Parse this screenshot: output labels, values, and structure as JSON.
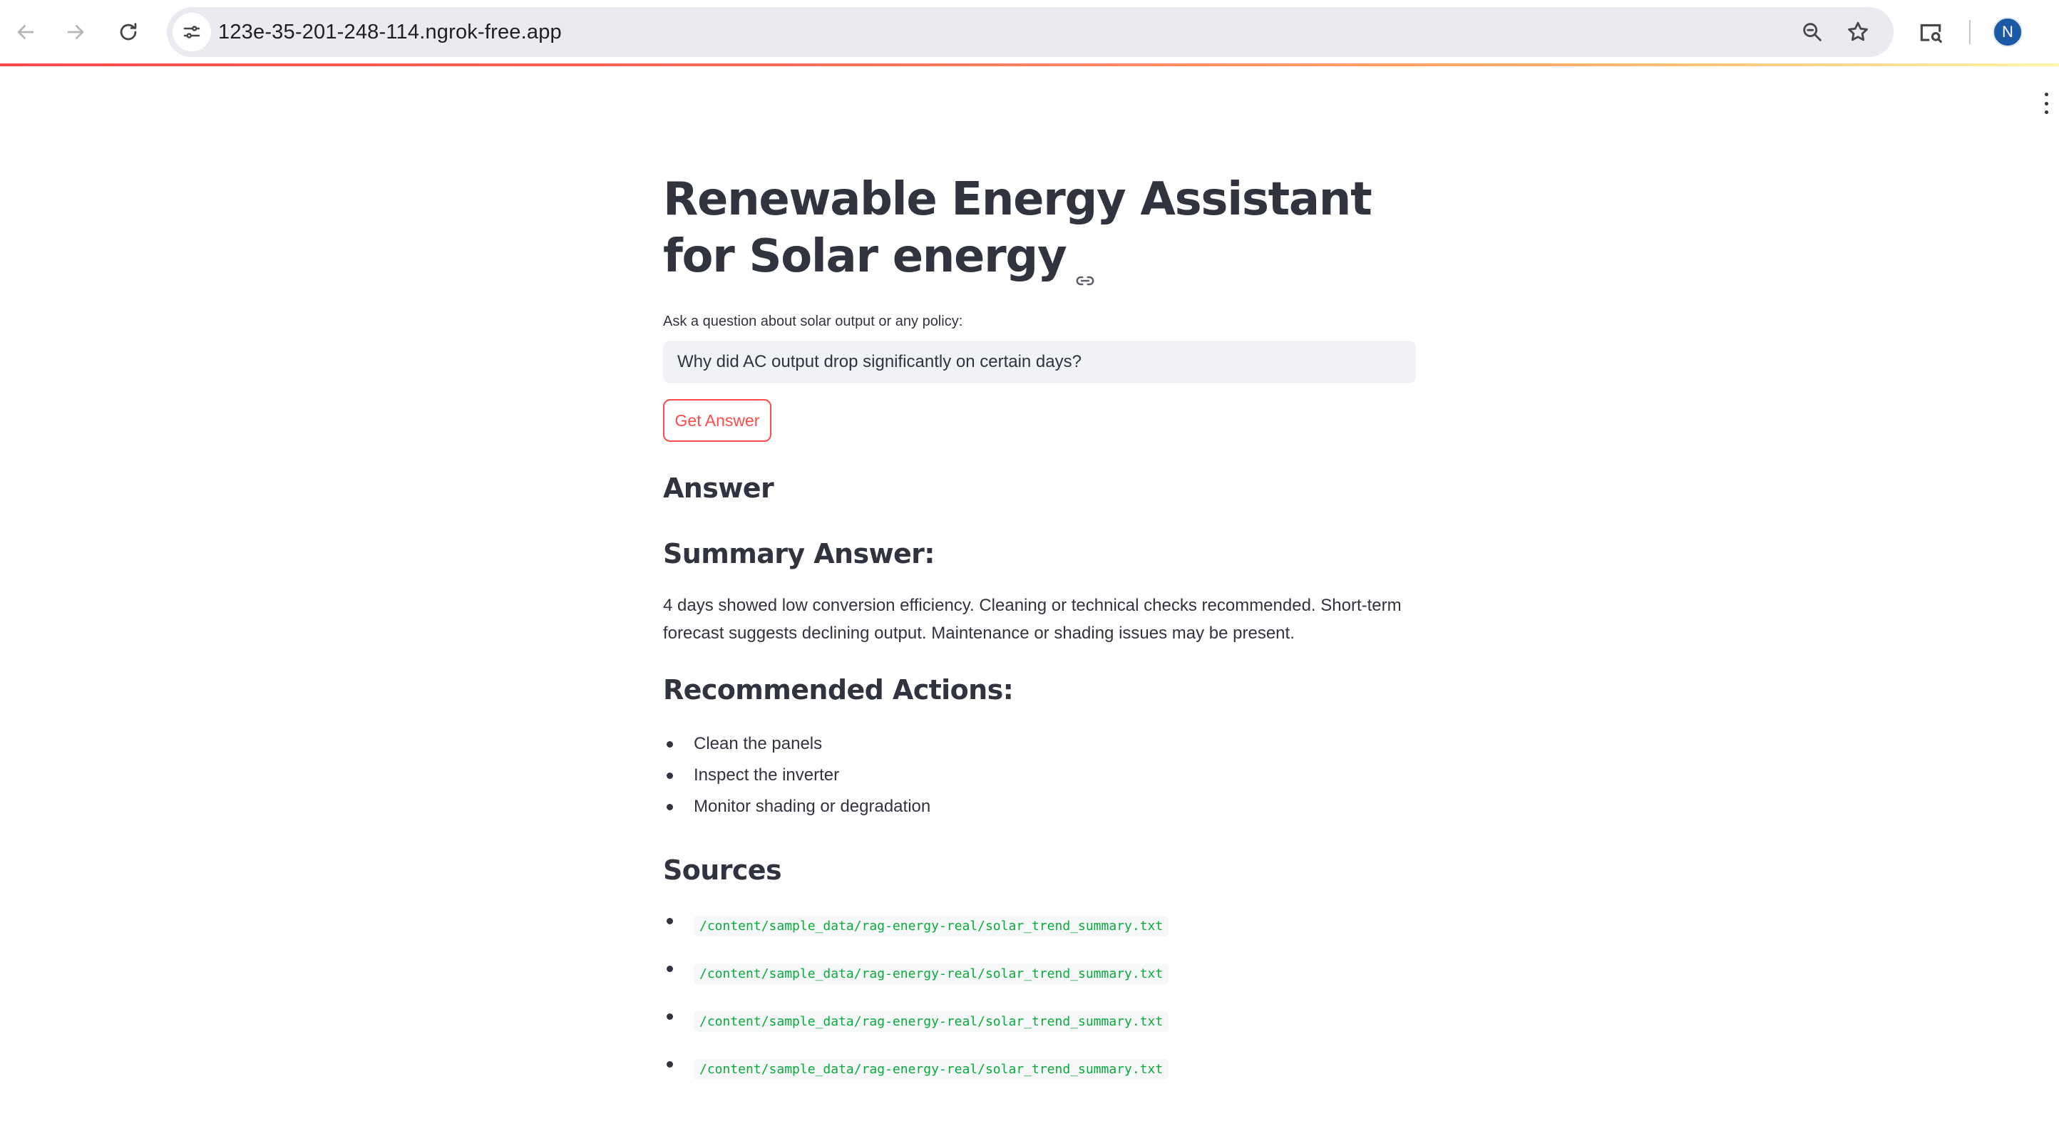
{
  "browser": {
    "url": "123e-35-201-248-114.ngrok-free.app",
    "profile_initial": "N",
    "icons": {
      "back": "arrow-left-icon",
      "forward": "arrow-right-icon",
      "reload": "reload-icon",
      "site_info": "tune-icon",
      "zoom": "zoom-icon",
      "bookmark": "star-icon",
      "cast": "screen-search-icon",
      "menu": "vertical-dots-icon"
    },
    "accent_gradient": [
      "#ff4b4b",
      "#ffad6a",
      "#fff6a8"
    ]
  },
  "app": {
    "title": "Renewable Energy Assistant for Solar energy",
    "input_label": "Ask a question about solar output or any policy:",
    "question_value": "Why did AC output drop significantly on certain days?",
    "button_label": "Get Answer",
    "answer_heading": "Answer",
    "summary_heading": "Summary Answer:",
    "summary_text": "4 days showed low conversion efficiency. Cleaning or technical checks recommended. Short-term forecast suggests declining output. Maintenance or shading issues may be present.",
    "actions_heading": "Recommended Actions:",
    "actions": [
      "Clean the panels",
      "Inspect the inverter",
      "Monitor shading or degradation"
    ],
    "sources_heading": "Sources",
    "sources": [
      "/content/sample_data/rag-energy-real/solar_trend_summary.txt",
      "/content/sample_data/rag-energy-real/solar_trend_summary.txt",
      "/content/sample_data/rag-energy-real/solar_trend_summary.txt",
      "/content/sample_data/rag-energy-real/solar_trend_summary.txt"
    ],
    "colors": {
      "primary": "#ff4b4b",
      "text": "#31333f",
      "code": "#09ab3b",
      "input_bg": "#f0f2f6"
    }
  }
}
